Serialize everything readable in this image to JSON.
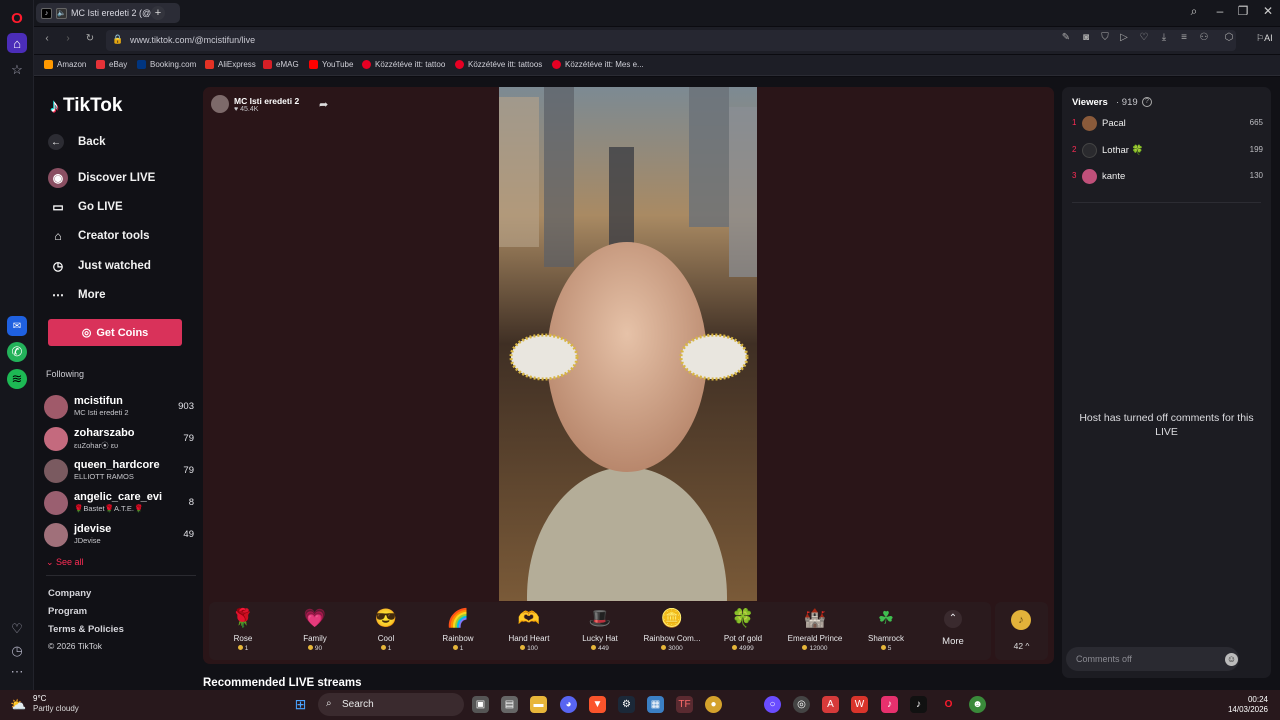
{
  "browser": {
    "tab_title": "MC Isti eredeti 2 (@m",
    "url": "www.tiktok.com/@mcistifun/live",
    "aria_label": "AI",
    "bookmarks": [
      {
        "label": "Amazon",
        "color": "#ff9900"
      },
      {
        "label": "eBay",
        "color": "#e53238"
      },
      {
        "label": "Booking.com",
        "color": "#003580"
      },
      {
        "label": "AliExpress",
        "color": "#e43225"
      },
      {
        "label": "eMAG",
        "color": "#d61f26"
      },
      {
        "label": "YouTube",
        "color": "#ff0000"
      },
      {
        "label": "Közzétéve itt: tattoo",
        "color": "#e60023"
      },
      {
        "label": "Közzétéve itt: tattoos",
        "color": "#e60023"
      },
      {
        "label": "Közzétéve itt: Mes e...",
        "color": "#e60023"
      }
    ]
  },
  "tiktok": {
    "logo_text": "TikTok",
    "nav": [
      {
        "label": "Back",
        "icon": "arrow-left-icon"
      },
      {
        "label": "Discover LIVE",
        "icon": "discover-icon"
      },
      {
        "label": "Go LIVE",
        "icon": "camera-icon"
      },
      {
        "label": "Creator tools",
        "icon": "home-icon"
      },
      {
        "label": "Just watched",
        "icon": "history-icon"
      },
      {
        "label": "More",
        "icon": "more-icon"
      }
    ],
    "get_coins": "Get Coins",
    "following_label": "Following",
    "following": [
      {
        "name": "mcistifun",
        "sub": "MC Isti eredeti 2",
        "count": "903"
      },
      {
        "name": "zoharszabo",
        "sub": "εuZohar⦿ ευ",
        "count": "79"
      },
      {
        "name": "queen_hardcore",
        "sub": "ELLIOTT RAMOS",
        "count": "79"
      },
      {
        "name": "angelic_care_evi",
        "sub": "🌹Bastet🌹A.T.E.🌹",
        "count": "8"
      },
      {
        "name": "jdevise",
        "sub": "JDevise",
        "count": "49"
      }
    ],
    "see_all": "See all",
    "footer": [
      "Company",
      "Program",
      "Terms & Policies",
      "© 2026 TikTok"
    ]
  },
  "live": {
    "host_name": "MC Isti eredeti 2",
    "host_likes": "♥ 45.4K",
    "gifts": [
      {
        "name": "Rose",
        "price": "1",
        "icon": "🌹"
      },
      {
        "name": "Family",
        "price": "90",
        "icon": "💗"
      },
      {
        "name": "Cool",
        "price": "1",
        "icon": "😎"
      },
      {
        "name": "Rainbow",
        "price": "1",
        "icon": "🌈"
      },
      {
        "name": "Hand Heart",
        "price": "100",
        "icon": "🫶"
      },
      {
        "name": "Lucky Hat",
        "price": "449",
        "icon": "🎩"
      },
      {
        "name": "Rainbow Com...",
        "price": "3000",
        "icon": "🪙"
      },
      {
        "name": "Pot of gold",
        "price": "4999",
        "icon": "🍀"
      },
      {
        "name": "Emerald Prince",
        "price": "12000",
        "icon": "🏰"
      },
      {
        "name": "Shamrock",
        "price": "5",
        "icon": "☘"
      }
    ],
    "more_label": "More",
    "coin_count": "42 ^",
    "recommended_heading": "Recommended LIVE streams"
  },
  "viewers": {
    "title": "Viewers",
    "count": "· 919",
    "list": [
      {
        "rank": "1",
        "name": "Pacal",
        "score": "665",
        "color": "#8a5a3a"
      },
      {
        "rank": "2",
        "name": "Lothar 🍀",
        "score": "199",
        "color": "#2a2a2e"
      },
      {
        "rank": "3",
        "name": "kante",
        "score": "130",
        "color": "#c0507a"
      }
    ],
    "comments_off_msg": "Host has turned off comments for this LIVE",
    "comment_placeholder": "Comments off"
  },
  "taskbar": {
    "temp": "9°C",
    "weather": "Partly cloudy",
    "search": "Search",
    "time": "00:24",
    "date": "14/03/2026"
  }
}
